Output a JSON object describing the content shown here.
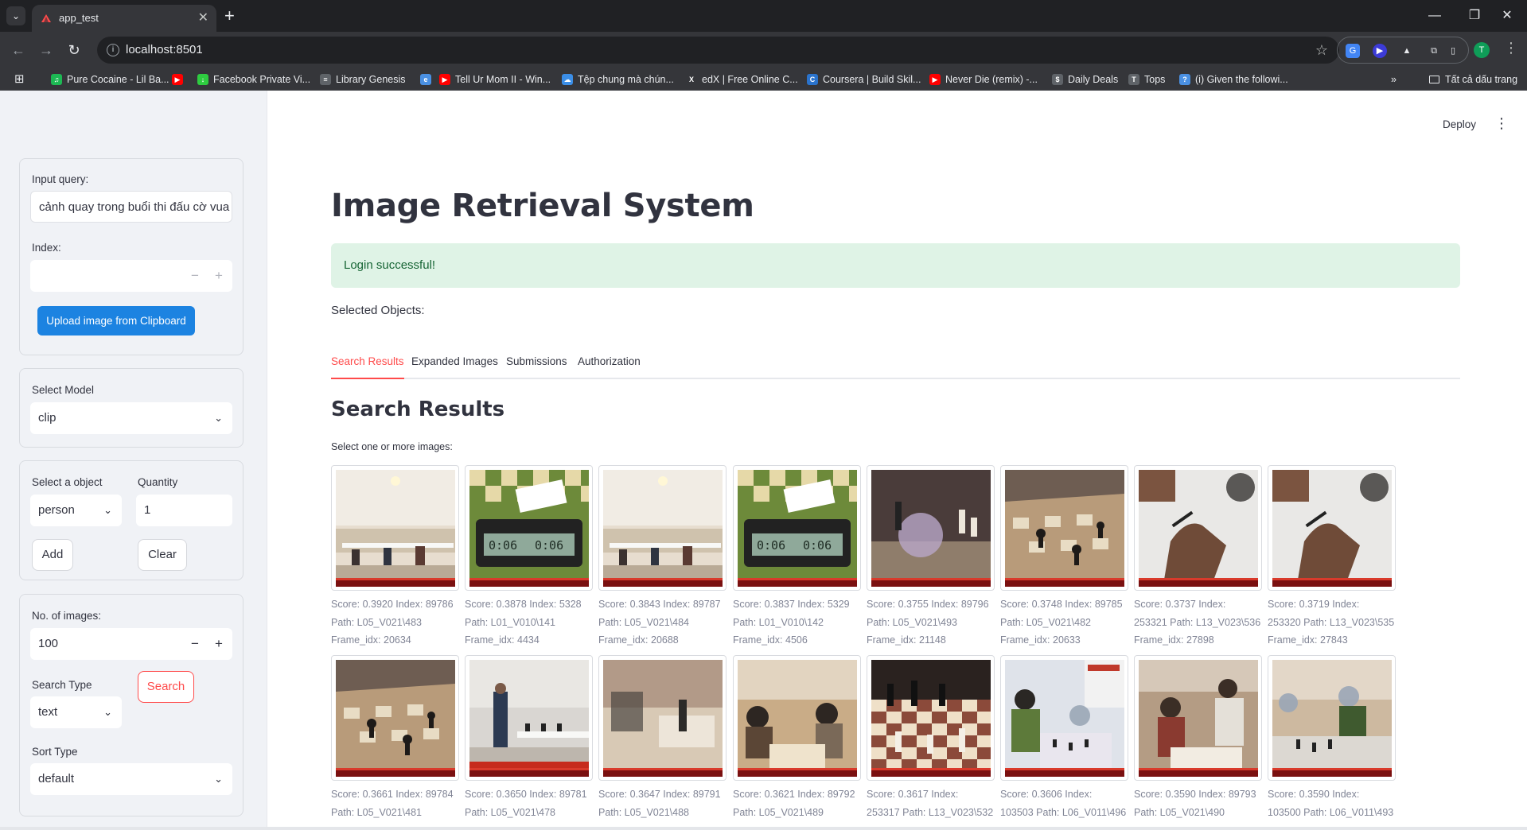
{
  "browser": {
    "tab_title": "app_test",
    "url": "localhost:8501",
    "profile_initial": "T",
    "bookmarks": [
      {
        "label": "Pure Cocaine - Lil Ba...",
        "icon": "spotify-icon",
        "color": "#1db954"
      },
      {
        "label": "",
        "icon": "youtube-icon",
        "color": "#ff0000"
      },
      {
        "label": "Facebook Private Vi...",
        "icon": "download-icon",
        "color": "#2ecc40"
      },
      {
        "label": "Library Genesis",
        "icon": "book-icon",
        "color": "#5f6368"
      },
      {
        "label": "",
        "icon": "edge-icon",
        "color": "#4a90e2"
      },
      {
        "label": "Tell Ur Mom II - Win...",
        "icon": "youtube-icon",
        "color": "#ff0000"
      },
      {
        "label": "Tệp chung mà chún...",
        "icon": "onedrive-icon",
        "color": "#3b8ee6"
      },
      {
        "label": "edX | Free Online C...",
        "icon": "edx-icon",
        "color": "#35363a"
      },
      {
        "label": "Coursera | Build Skil...",
        "icon": "coursera-icon",
        "color": "#2a73cc"
      },
      {
        "label": "Never Die (remix) -...",
        "icon": "youtube-icon",
        "color": "#ff0000"
      },
      {
        "label": "Daily Deals",
        "icon": "deals-icon",
        "color": "#5f6368"
      },
      {
        "label": "Tops",
        "icon": "tops-icon",
        "color": "#5f6368"
      },
      {
        "label": "(i) Given the followi...",
        "icon": "help-icon",
        "color": "#4a90e2"
      }
    ],
    "all_bookmarks": "Tất cả dấu trang"
  },
  "sidebar": {
    "query_label": "Input query:",
    "query_value": "cảnh quay trong buổi thi đấu cờ vua",
    "index_label": "Index:",
    "index_value": "",
    "upload_button": "Upload image from Clipboard",
    "model_label": "Select Model",
    "model_value": "clip",
    "object_label": "Select a object",
    "object_value": "person",
    "quantity_label": "Quantity",
    "quantity_value": "1",
    "add_button": "Add",
    "clear_button": "Clear",
    "num_images_label": "No. of images:",
    "num_images_value": "100",
    "search_type_label": "Search Type",
    "search_type_value": "text",
    "search_button": "Search",
    "sort_type_label": "Sort Type",
    "sort_type_value": "default"
  },
  "main": {
    "deploy": "Deploy",
    "title": "Image Retrieval System",
    "alert": "Login successful!",
    "selected_objects": "Selected Objects:",
    "tabs": [
      "Search Results",
      "Expanded Images",
      "Submissions",
      "Authorization"
    ],
    "section_title": "Search Results",
    "select_prompt": "Select one or more images:"
  },
  "results": [
    {
      "l1": "Score: 0.3920 Index: 89786",
      "l2": "Path: L05_V021\\483",
      "l3": "Frame_idx: 20634",
      "scene": "hall"
    },
    {
      "l1": "Score: 0.3878 Index: 5328",
      "l2": "Path: L01_V010\\141",
      "l3": "Frame_idx: 4434",
      "scene": "clock"
    },
    {
      "l1": "Score: 0.3843 Index: 89787",
      "l2": "Path: L05_V021\\484",
      "l3": "Frame_idx: 20688",
      "scene": "hall"
    },
    {
      "l1": "Score: 0.3837 Index: 5329",
      "l2": "Path: L01_V010\\142",
      "l3": "Frame_idx: 4506",
      "scene": "clock"
    },
    {
      "l1": "Score: 0.3755 Index: 89796",
      "l2": "Path: L05_V021\\493",
      "l3": "Frame_idx: 21148",
      "scene": "blur"
    },
    {
      "l1": "Score: 0.3748 Index: 89785",
      "l2": "Path: L05_V021\\482",
      "l3": "Frame_idx: 20633",
      "scene": "pieces"
    },
    {
      "l1": "Score: 0.3737 Index:",
      "l2": "253321 Path: L13_V023\\536",
      "l3": "Frame_idx: 27898",
      "scene": "hand"
    },
    {
      "l1": "Score: 0.3719 Index:",
      "l2": "253320 Path: L13_V023\\535",
      "l3": "Frame_idx: 27843",
      "scene": "hand"
    },
    {
      "l1": "Score: 0.3661 Index: 89784",
      "l2": "Path: L05_V021\\481",
      "l3": "",
      "scene": "pieces"
    },
    {
      "l1": "Score: 0.3650 Index: 89781",
      "l2": "Path: L05_V021\\478",
      "l3": "",
      "scene": "hall2"
    },
    {
      "l1": "Score: 0.3647 Index: 89791",
      "l2": "Path: L05_V021\\488",
      "l3": "",
      "scene": "blur2"
    },
    {
      "l1": "Score: 0.3621 Index: 89792",
      "l2": "Path: L05_V021\\489",
      "l3": "",
      "scene": "players"
    },
    {
      "l1": "Score: 0.3617 Index:",
      "l2": "253317 Path: L13_V023\\532",
      "l3": "",
      "scene": "board"
    },
    {
      "l1": "Score: 0.3606 Index:",
      "l2": "103503 Path: L06_V011\\496",
      "l3": "",
      "scene": "kids"
    },
    {
      "l1": "Score: 0.3590 Index: 89793",
      "l2": "Path: L05_V021\\490",
      "l3": "",
      "scene": "players2"
    },
    {
      "l1": "Score: 0.3590 Index:",
      "l2": "103500 Path: L06_V011\\493",
      "l3": "",
      "scene": "kids2"
    }
  ]
}
